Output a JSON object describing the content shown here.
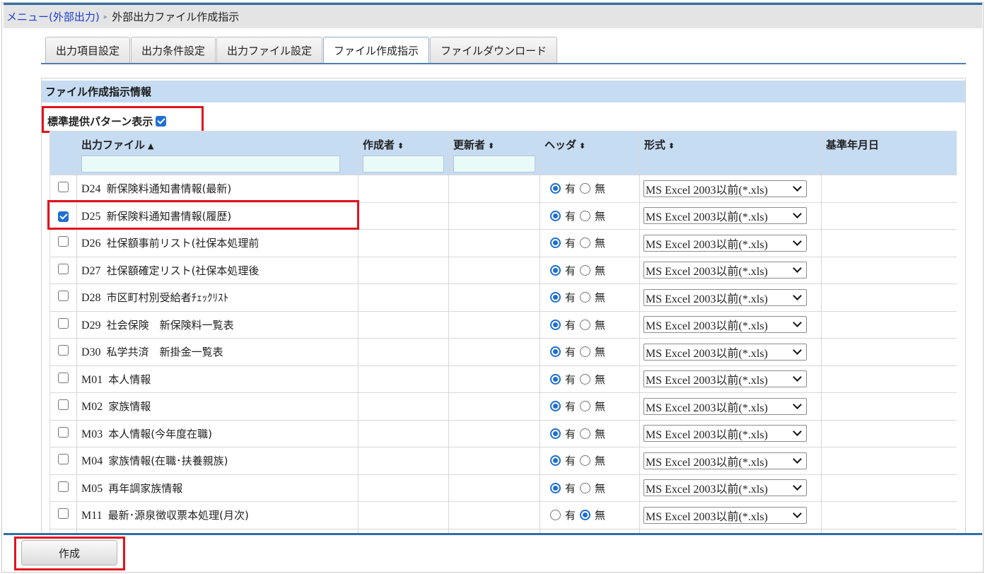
{
  "breadcrumb": {
    "parent": "メニュー(外部出力)",
    "current": "外部出力ファイル作成指示"
  },
  "tabs": [
    {
      "label": "出力項目設定",
      "active": false
    },
    {
      "label": "出力条件設定",
      "active": false
    },
    {
      "label": "出力ファイル設定",
      "active": false
    },
    {
      "label": "ファイル作成指示",
      "active": true
    },
    {
      "label": "ファイルダウンロード",
      "active": false
    }
  ],
  "section": {
    "title": "ファイル作成指示情報"
  },
  "pattern_toggle": {
    "label": "標準提供パターン表示",
    "checked": true
  },
  "table": {
    "headers": {
      "file": "出力ファイル",
      "file_sort": "▲",
      "creator": "作成者",
      "creator_sort": "⬍",
      "updater": "更新者",
      "updater_sort": "⬍",
      "header": "ヘッダ",
      "header_sort": "⬍",
      "format": "形式",
      "format_sort": "⬍",
      "base_date": "基準年月日"
    },
    "radio_labels": {
      "yes": "有",
      "no": "無"
    },
    "rows": [
      {
        "code": "D24",
        "name": "新保険料通知書情報(最新)",
        "checked": false,
        "header": "yes",
        "format": "MS Excel 2003以前(*.xls)"
      },
      {
        "code": "D25",
        "name": "新保険料通知書情報(履歴)",
        "checked": true,
        "header": "yes",
        "format": "MS Excel 2003以前(*.xls)"
      },
      {
        "code": "D26",
        "name": "社保額事前リスト(社保本処理前",
        "checked": false,
        "header": "yes",
        "format": "MS Excel 2003以前(*.xls)"
      },
      {
        "code": "D27",
        "name": "社保額確定リスト(社保本処理後",
        "checked": false,
        "header": "yes",
        "format": "MS Excel 2003以前(*.xls)"
      },
      {
        "code": "D28",
        "name": "市区町村別受給者ﾁｪｯｸﾘｽﾄ",
        "checked": false,
        "header": "yes",
        "format": "MS Excel 2003以前(*.xls)"
      },
      {
        "code": "D29",
        "name": "社会保険　新保険料一覧表",
        "checked": false,
        "header": "yes",
        "format": "MS Excel 2003以前(*.xls)"
      },
      {
        "code": "D30",
        "name": "私学共済　新掛金一覧表",
        "checked": false,
        "header": "yes",
        "format": "MS Excel 2003以前(*.xls)"
      },
      {
        "code": "M01",
        "name": "本人情報",
        "checked": false,
        "header": "yes",
        "format": "MS Excel 2003以前(*.xls)"
      },
      {
        "code": "M02",
        "name": "家族情報",
        "checked": false,
        "header": "yes",
        "format": "MS Excel 2003以前(*.xls)"
      },
      {
        "code": "M03",
        "name": "本人情報(今年度在職)",
        "checked": false,
        "header": "yes",
        "format": "MS Excel 2003以前(*.xls)"
      },
      {
        "code": "M04",
        "name": "家族情報(在職･扶養親族)",
        "checked": false,
        "header": "yes",
        "format": "MS Excel 2003以前(*.xls)"
      },
      {
        "code": "M05",
        "name": "再年調家族情報",
        "checked": false,
        "header": "yes",
        "format": "MS Excel 2003以前(*.xls)"
      },
      {
        "code": "M11",
        "name": "最新･源泉徴収票本処理(月次)",
        "checked": false,
        "header": "no",
        "format": "MS Excel 2003以前(*.xls)"
      },
      {
        "code": "",
        "name": "",
        "checked": false,
        "header": "",
        "format": ""
      }
    ]
  },
  "buttons": {
    "create": "作成"
  },
  "colors": {
    "accent_line": "#2f6fa6",
    "header_bg": "#c6dcf2",
    "highlight_box": "#e0141e",
    "link": "#1a3fd6"
  }
}
